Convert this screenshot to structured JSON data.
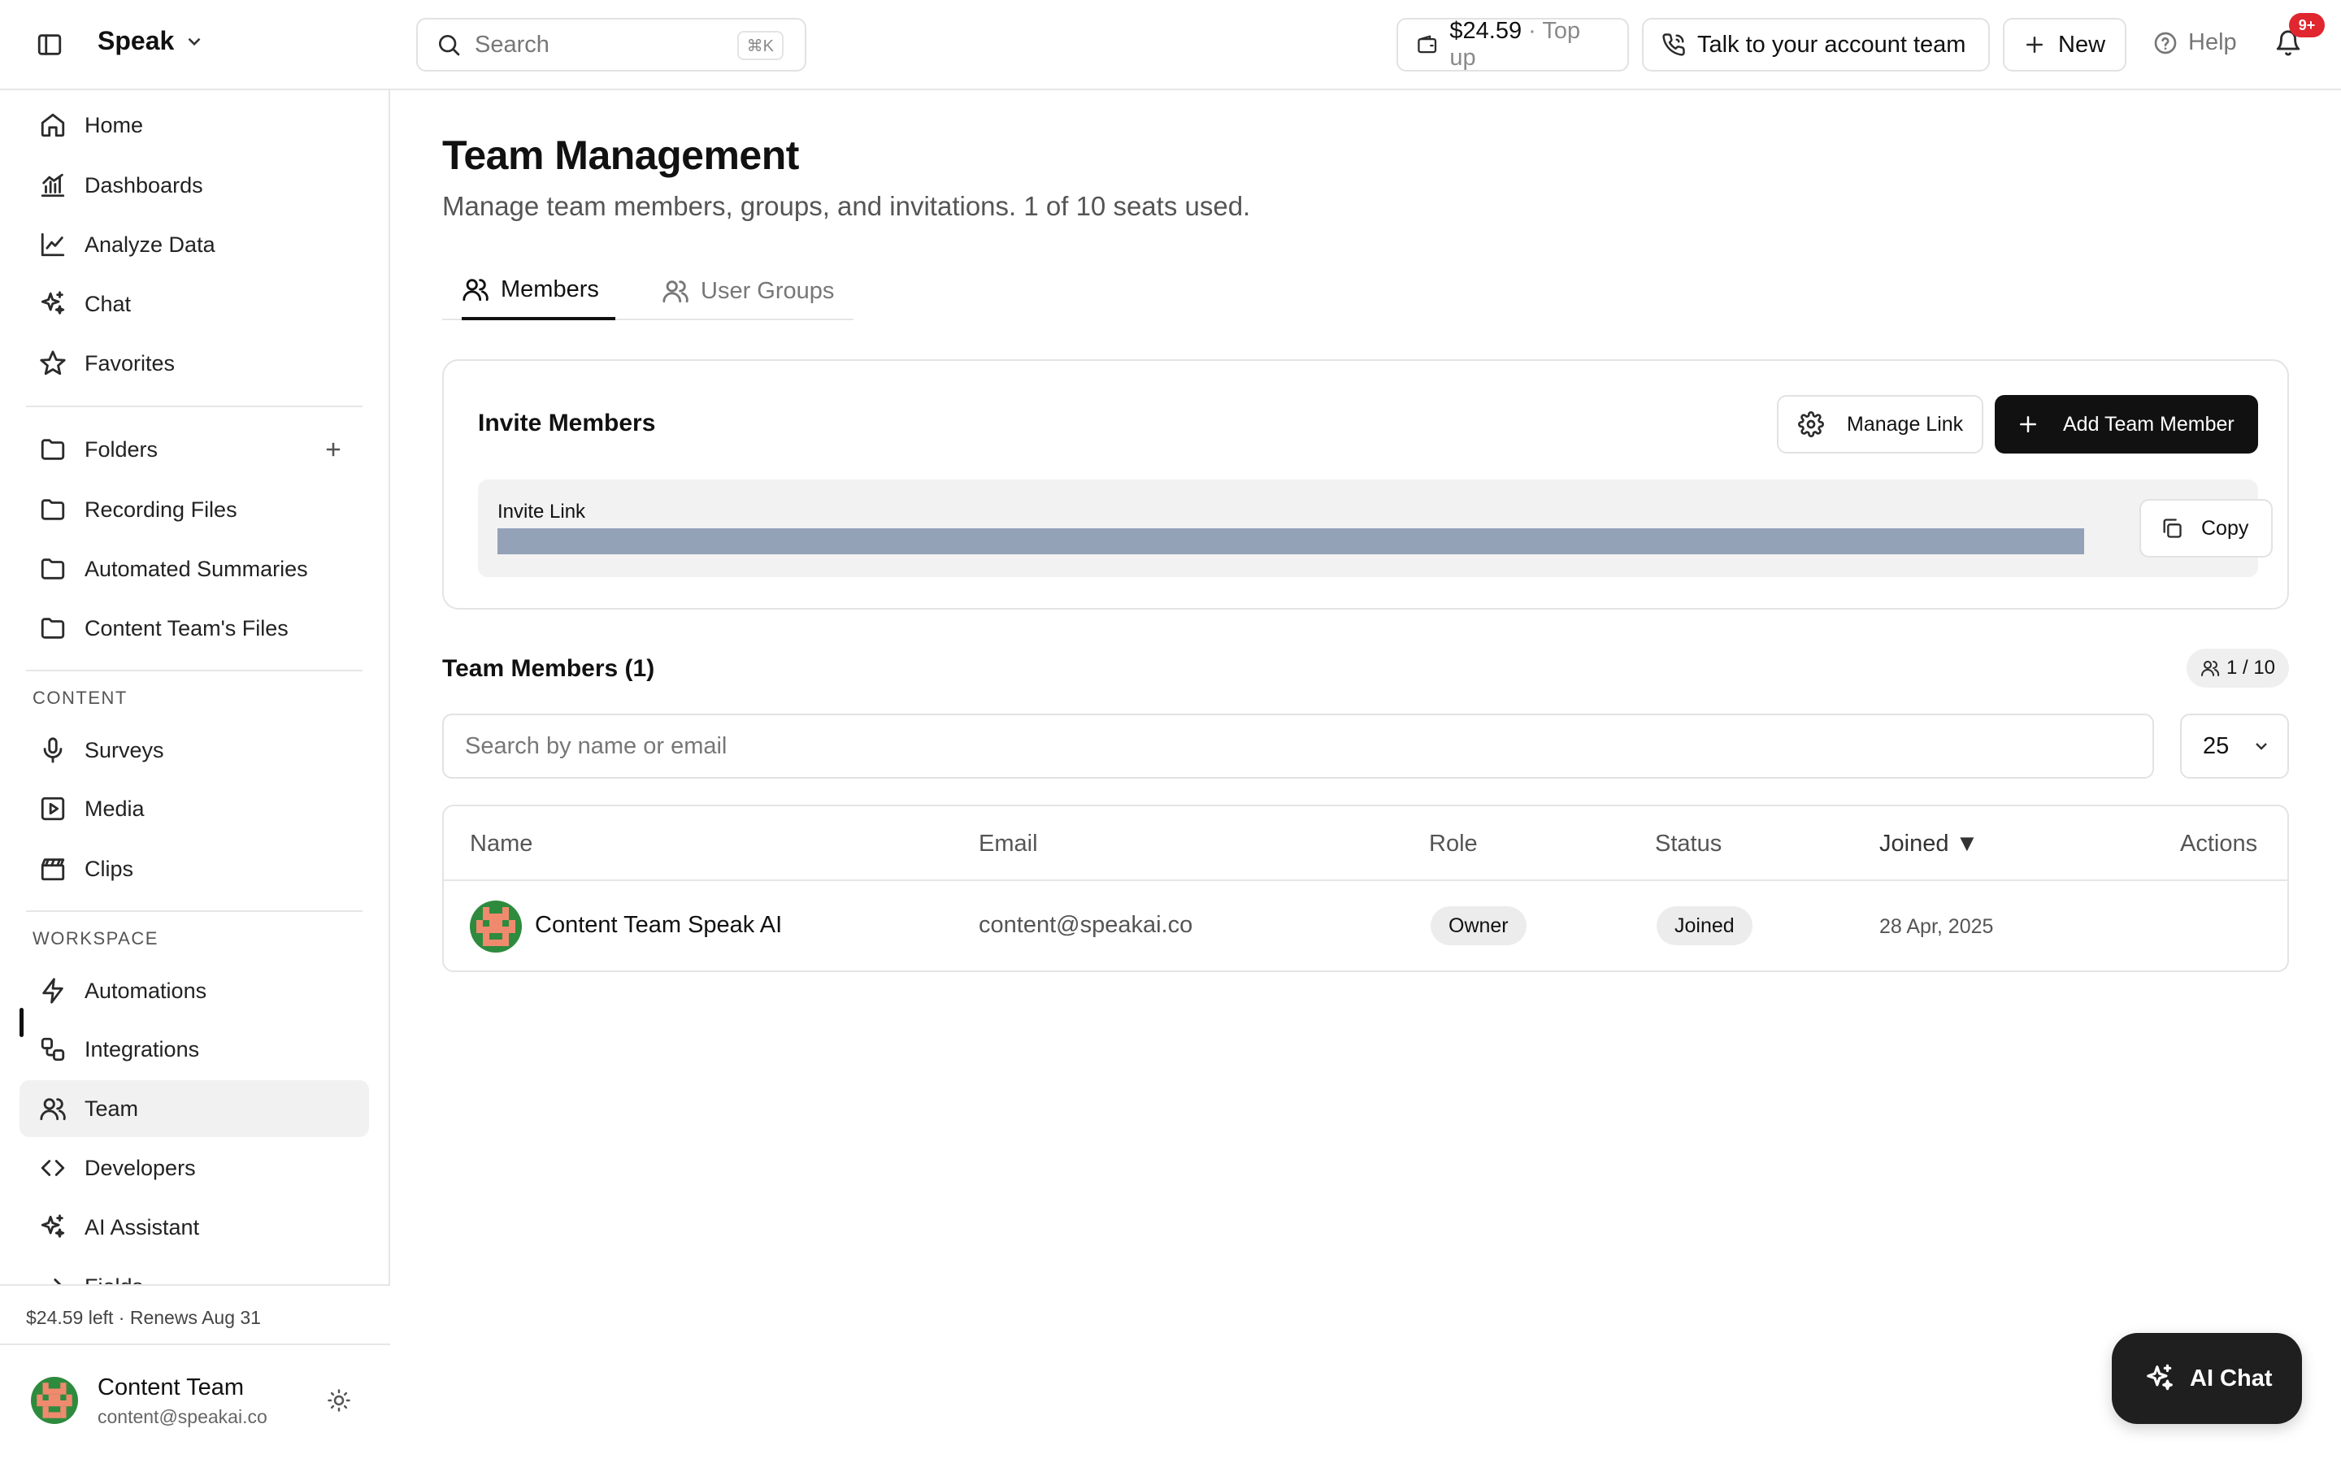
{
  "topbar": {
    "brand": "Speak",
    "search_placeholder": "Search",
    "search_shortcut": "⌘K",
    "balance_amount": "$24.59",
    "balance_action": "· Top up",
    "talk_label": "Talk to your account team",
    "new_label": "New",
    "help_label": "Help",
    "notification_count": "9+"
  },
  "sidebar": {
    "main_items": [
      {
        "label": "Home",
        "icon": "home-icon"
      },
      {
        "label": "Dashboards",
        "icon": "bar-chart-icon"
      },
      {
        "label": "Analyze Data",
        "icon": "line-chart-icon"
      },
      {
        "label": "Chat",
        "icon": "sparkles-icon"
      },
      {
        "label": "Favorites",
        "icon": "star-icon"
      }
    ],
    "folder_items": [
      {
        "label": "Folders",
        "icon": "folder-icon"
      },
      {
        "label": "Recording Files",
        "icon": "folder-icon"
      },
      {
        "label": "Automated Summaries",
        "icon": "folder-icon"
      },
      {
        "label": "Content Team's Files",
        "icon": "folder-icon"
      }
    ],
    "content_label": "CONTENT",
    "content_items": [
      {
        "label": "Surveys",
        "icon": "microphone-icon"
      },
      {
        "label": "Media",
        "icon": "play-square-icon"
      },
      {
        "label": "Clips",
        "icon": "clapperboard-icon"
      }
    ],
    "workspace_label": "WORKSPACE",
    "workspace_items": [
      {
        "label": "Automations",
        "icon": "lightning-icon"
      },
      {
        "label": "Integrations",
        "icon": "integrations-icon"
      },
      {
        "label": "Team",
        "icon": "users-icon"
      },
      {
        "label": "Developers",
        "icon": "code-icon"
      },
      {
        "label": "AI Assistant",
        "icon": "sparkles-icon"
      },
      {
        "label": "Fields",
        "icon": "arrow-right-icon"
      }
    ],
    "active_item": "Team",
    "credits_text": "$24.59 left · Renews Aug 31",
    "user_name": "Content Team",
    "user_email": "content@speakai.co"
  },
  "main": {
    "title": "Team Management",
    "subtitle": "Manage team members, groups, and invitations. 1 of 10 seats used.",
    "tabs": [
      {
        "label": "Members",
        "active": true
      },
      {
        "label": "User Groups",
        "active": false
      }
    ],
    "invite": {
      "title": "Invite Members",
      "manage_link_label": "Manage Link",
      "add_member_label": "Add Team Member",
      "link_label": "Invite Link",
      "copy_label": "Copy"
    },
    "members": {
      "heading": "Team Members (1)",
      "seats": "1 / 10",
      "search_placeholder": "Search by name or email",
      "page_size": "25",
      "columns": [
        "Name",
        "Email",
        "Role",
        "Status",
        "Joined ▼",
        "Actions"
      ],
      "rows": [
        {
          "name": "Content Team Speak AI",
          "email": "content@speakai.co",
          "role": "Owner",
          "status": "Joined",
          "joined": "28 Apr, 2025"
        }
      ]
    },
    "ai_chat_label": "AI Chat"
  },
  "colors": {
    "accent": "#111111",
    "badge": "#e0262f",
    "link_bar": "#94a2b8",
    "avatar_green": "#2e8b3e",
    "avatar_salmon": "#f08a6e"
  }
}
